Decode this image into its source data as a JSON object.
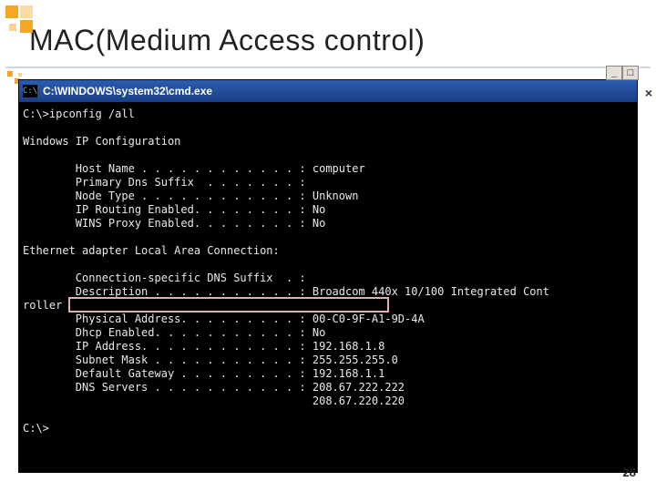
{
  "slide": {
    "title": "MAC(Medium Access control)",
    "page_number": "28"
  },
  "window": {
    "icon_label": "C:\\",
    "title": "C:\\WINDOWS\\system32\\cmd.exe",
    "buttons": {
      "min": "_",
      "max": "□",
      "close": "×"
    }
  },
  "terminal": {
    "prompt1": "C:\\>ipconfig /all",
    "header": "Windows IP Configuration",
    "line_host": "        Host Name . . . . . . . . . . . . : computer",
    "line_dns": "        Primary Dns Suffix  . . . . . . . :",
    "line_node": "        Node Type . . . . . . . . . . . . : Unknown",
    "line_iprout": "        IP Routing Enabled. . . . . . . . : No",
    "line_wins": "        WINS Proxy Enabled. . . . . . . . : No",
    "adapter_header": "Ethernet adapter Local Area Connection:",
    "line_csuffix": "        Connection-specific DNS Suffix  . :",
    "line_desc": "        Description . . . . . . . . . . . : Broadcom 440x 10/100 Integrated Cont",
    "line_desc_wrap": "roller",
    "line_phys": "        Physical Address. . . . . . . . . : 00-C0-9F-A1-9D-4A",
    "line_dhcp": "        Dhcp Enabled. . . . . . . . . . . : No",
    "line_ip": "        IP Address. . . . . . . . . . . . : 192.168.1.8",
    "line_mask": "        Subnet Mask . . . . . . . . . . . : 255.255.255.0",
    "line_gw": "        Default Gateway . . . . . . . . . : 192.168.1.1",
    "line_dns1": "        DNS Servers . . . . . . . . . . . : 208.67.222.222",
    "line_dns2": "                                            208.67.220.220",
    "prompt2": "C:\\>"
  },
  "side_close": "×"
}
